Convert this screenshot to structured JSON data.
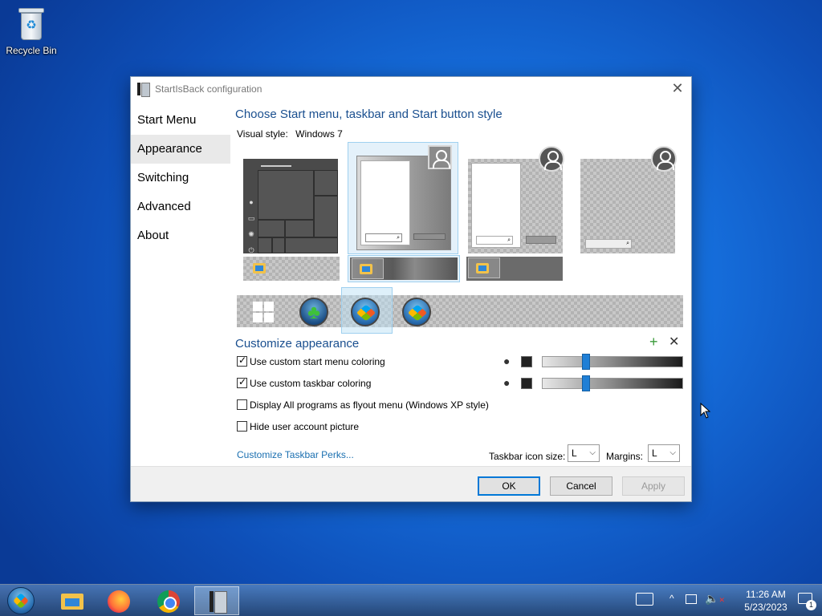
{
  "desktop": {
    "icons": [
      {
        "label": "Recycle Bin",
        "icon": "recycle-bin-icon"
      }
    ]
  },
  "dialog": {
    "title": "StartIsBack configuration",
    "close_glyph": "✕",
    "sidebar": {
      "items": [
        {
          "label": "Start Menu",
          "active": false
        },
        {
          "label": "Appearance",
          "active": true
        },
        {
          "label": "Switching",
          "active": false
        },
        {
          "label": "Advanced",
          "active": false
        },
        {
          "label": "About",
          "active": false
        }
      ]
    },
    "style_section": {
      "heading": "Choose Start menu, taskbar and Start button style",
      "visual_style_label": "Visual style:",
      "visual_style_value": "Windows 7",
      "menu_styles": [
        "windows-10-style",
        "windows-7-style",
        "windows-7-classic-style",
        "plain-style"
      ],
      "selected_menu_style": 1,
      "selected_taskbar_style": 1,
      "selected_start_button": 2
    },
    "customize": {
      "heading": "Customize appearance",
      "add_glyph": "+",
      "remove_glyph": "✕",
      "options": [
        {
          "label": "Use custom start menu coloring",
          "checked": true
        },
        {
          "label": "Use custom taskbar coloring",
          "checked": true
        },
        {
          "label": "Display All programs as flyout menu (Windows XP style)",
          "checked": false
        },
        {
          "label": "Hide user account picture",
          "checked": false
        }
      ],
      "slider_values": [
        0.3,
        0.3
      ],
      "link": "Customize Taskbar Perks...",
      "taskbar_icon_size_label": "Taskbar icon size:",
      "taskbar_icon_size_value": "L",
      "margins_label": "Margins:",
      "margins_value": "L"
    },
    "buttons": {
      "ok": "OK",
      "cancel": "Cancel",
      "apply": "Apply"
    }
  },
  "taskbar": {
    "apps": [
      "file-explorer-icon",
      "firefox-icon",
      "chrome-icon",
      "startisback-icon"
    ],
    "active_app": 3,
    "clock_time": "11:26 AM",
    "clock_date": "5/23/2023",
    "notification_count": "1",
    "tray_chevron": "^"
  },
  "colors": {
    "accent": "#0078d7",
    "heading": "#1a4f8f",
    "link": "#1a6fb0"
  }
}
